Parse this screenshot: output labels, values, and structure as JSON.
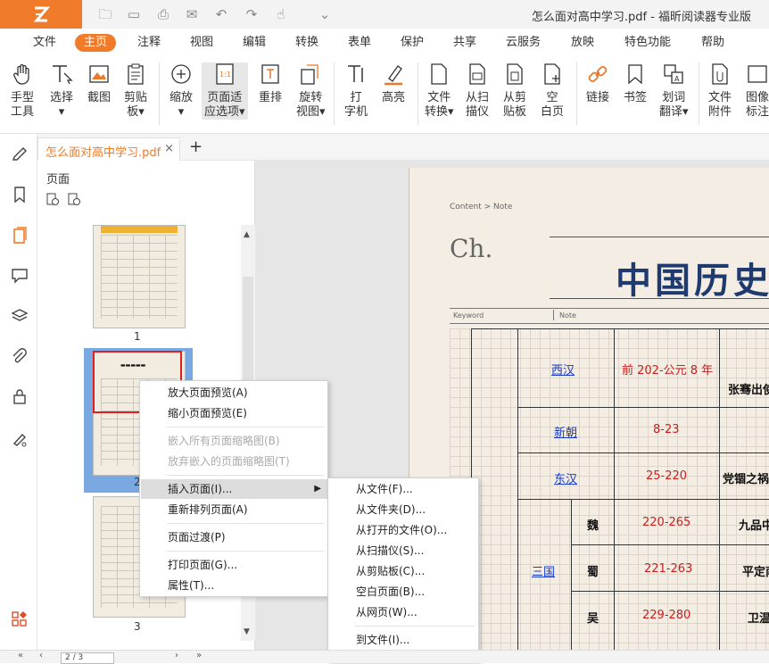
{
  "titlebar": {
    "title": "怎么面对高中学习.pdf - 福昕阅读器专业版",
    "quick_access": [
      "open-folder-icon",
      "save-icon",
      "print-icon",
      "undo-icon",
      "redo-icon",
      "hand-icon",
      "dropdown-icon"
    ]
  },
  "menubar": {
    "items": [
      "文件",
      "主页",
      "注释",
      "视图",
      "编辑",
      "转换",
      "表单",
      "保护",
      "共享",
      "云服务",
      "放映",
      "特色功能",
      "帮助"
    ],
    "active": "主页"
  },
  "ribbon": {
    "tools": [
      {
        "line1": "手型",
        "line2": "工具"
      },
      {
        "line1": "选择",
        "line2": "▾"
      },
      {
        "line1": "截图",
        "line2": ""
      },
      {
        "line1": "剪贴",
        "line2": "板▾"
      },
      {
        "line1": "缩放",
        "line2": "▾"
      },
      {
        "line1": "页面适",
        "line2": "应选项▾"
      },
      {
        "line1": "重排",
        "line2": ""
      },
      {
        "line1": "旋转",
        "line2": "视图▾"
      },
      {
        "line1": "打",
        "line2": "字机"
      },
      {
        "line1": "高亮",
        "line2": ""
      },
      {
        "line1": "文件",
        "line2": "转换▾"
      },
      {
        "line1": "从扫",
        "line2": "描仪"
      },
      {
        "line1": "从剪",
        "line2": "贴板"
      },
      {
        "line1": "空",
        "line2": "白页"
      },
      {
        "line1": "链接",
        "line2": ""
      },
      {
        "line1": "书签",
        "line2": ""
      },
      {
        "line1": "划词",
        "line2": "翻译▾"
      },
      {
        "line1": "文件",
        "line2": "附件"
      },
      {
        "line1": "图像",
        "line2": "标注"
      }
    ]
  },
  "tab": {
    "title": "怎么面对高中学习.pdf",
    "close": "×",
    "new": "+"
  },
  "panel": {
    "title": "页面",
    "page_numbers": [
      "1",
      "2",
      "3"
    ]
  },
  "context_menu": {
    "items": [
      {
        "label": "放大页面预览(A)",
        "enabled": true
      },
      {
        "label": "缩小页面预览(E)",
        "enabled": true
      },
      {
        "label": "嵌入所有页面缩略图(B)",
        "enabled": false
      },
      {
        "label": "放弃嵌入的页面缩略图(T)",
        "enabled": false
      },
      {
        "label": "插入页面(I)...",
        "enabled": true,
        "submenu": true
      },
      {
        "label": "重新排列页面(A)",
        "enabled": true
      },
      {
        "label": "页面过渡(P)",
        "enabled": true
      },
      {
        "label": "打印页面(G)...",
        "enabled": true
      },
      {
        "label": "属性(T)...",
        "enabled": true
      }
    ],
    "submenu": [
      "从文件(F)...",
      "从文件夹(D)...",
      "从打开的文件(O)...",
      "从扫描仪(S)...",
      "从剪贴板(C)...",
      "空白页面(B)...",
      "从网页(W)...",
      "到文件(I)..."
    ]
  },
  "document": {
    "breadcrumb": "Content > Note",
    "chapter": "Ch.",
    "title": "中国历史",
    "keyword_label": "Keyword",
    "note_label": "Note",
    "rows": [
      {
        "dynasty": "西汉",
        "years": "前 202-公元 8 年",
        "note": "张骞出使"
      },
      {
        "dynasty": "新朝",
        "years": "8-23",
        "note": ""
      },
      {
        "dynasty": "东汉",
        "years": "25-220",
        "note": "党锢之祸"
      },
      {
        "group": "三国",
        "dynasty": "魏",
        "years": "220-265",
        "note": "九品中"
      },
      {
        "dynasty": "蜀",
        "years": "221-263",
        "note": "平定南"
      },
      {
        "dynasty": "吴",
        "years": "229-280",
        "note": "卫温"
      }
    ]
  },
  "status": {
    "page_field": "2 / 3"
  },
  "colors": {
    "accent": "#f07b2a",
    "link": "#1a3cc8",
    "years": "#c81e1e",
    "title": "#1e3a6e"
  }
}
